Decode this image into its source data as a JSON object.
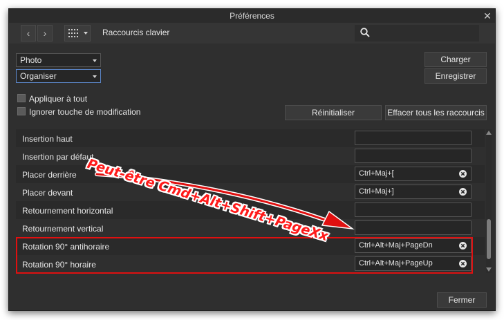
{
  "window": {
    "title": "Préférences",
    "close_glyph": "✕"
  },
  "toolbar": {
    "back_glyph": "‹",
    "forward_glyph": "›",
    "section_title": "Raccourcis clavier",
    "grid_icon": "grid-icon",
    "search_icon": "search-icon"
  },
  "selectors": {
    "persona": "Photo",
    "category": "Organiser"
  },
  "buttons": {
    "load": "Charger",
    "save": "Enregistrer",
    "reset": "Réinitialiser",
    "clear_all": "Effacer tous les raccourcis",
    "close": "Fermer"
  },
  "options": {
    "apply_all": "Appliquer à tout",
    "ignore_modifier": "Ignorer touche de modification"
  },
  "shortcuts": [
    {
      "label": "Insertion haut",
      "value": ""
    },
    {
      "label": "Insertion par défaut",
      "value": ""
    },
    {
      "label": "Placer derrière",
      "value": "Ctrl+Maj+["
    },
    {
      "label": "Placer devant",
      "value": "Ctrl+Maj+]"
    },
    {
      "label": "Retournement horizontal",
      "value": ""
    },
    {
      "label": "Retournement vertical",
      "value": ""
    },
    {
      "label": "Rotation 90° antihoraire",
      "value": "Ctrl+Alt+Maj+PageDn"
    },
    {
      "label": "Rotation 90° horaire",
      "value": "Ctrl+Alt+Maj+PageUp"
    }
  ],
  "annotation": {
    "text": "Peut-être Cmd+Alt+Shift+PageXx",
    "color": "#ff1a1a"
  },
  "colors": {
    "highlight": "#e01010",
    "accent": "#5b86c8"
  }
}
